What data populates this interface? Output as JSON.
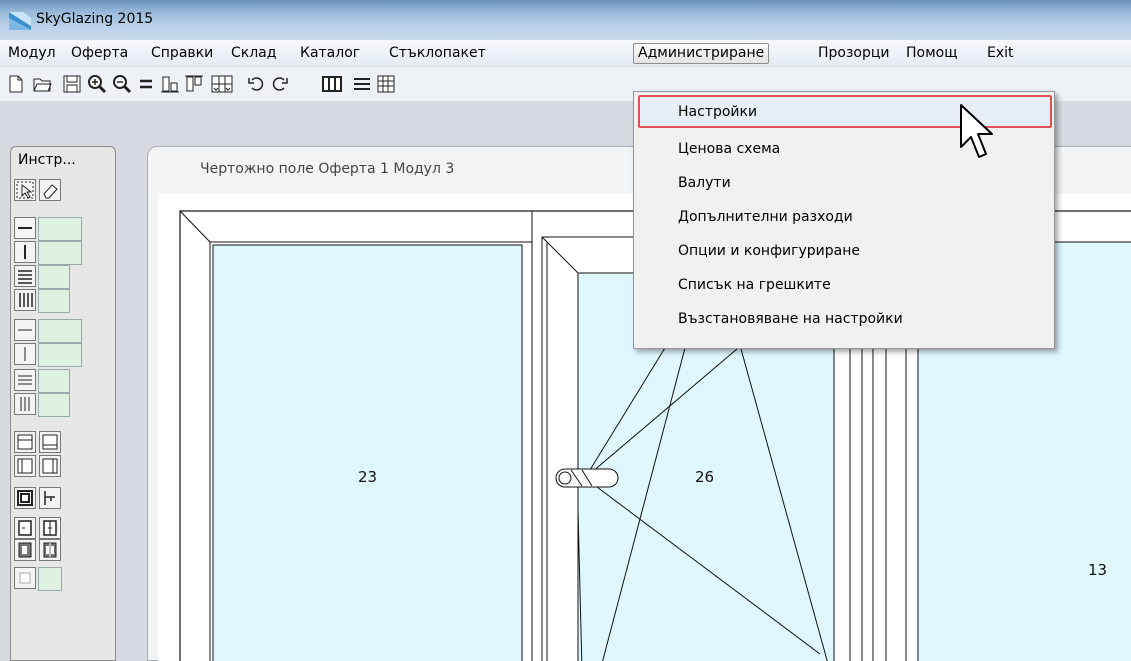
{
  "window": {
    "title": "SkyGlazing 2015"
  },
  "menu": {
    "items": [
      "Модул",
      "Оферта",
      "Справки",
      "Склад",
      "Каталог",
      "Стъклопакет",
      "Администриране",
      "Прозорци",
      "Помощ",
      "Exit"
    ],
    "active": "Администриране"
  },
  "tool_panel": {
    "tab_label": "Инстр..."
  },
  "drawing": {
    "label": "Чертожно поле  Оферта 1  Модул 3",
    "pane_numbers": [
      "23",
      "26",
      "13"
    ]
  },
  "dropdown": {
    "items": [
      "Настройки",
      "Ценова схема",
      "Валути",
      "Допълнителни разходи",
      "Опции и конфигуриране",
      "Списък на грешките",
      "Възстановяване на настройки"
    ],
    "highlighted": "Настройки"
  },
  "colors": {
    "glass": "#dff8ff",
    "highlight_border": "#e0505a",
    "panel_green": "#ddf0e2"
  }
}
